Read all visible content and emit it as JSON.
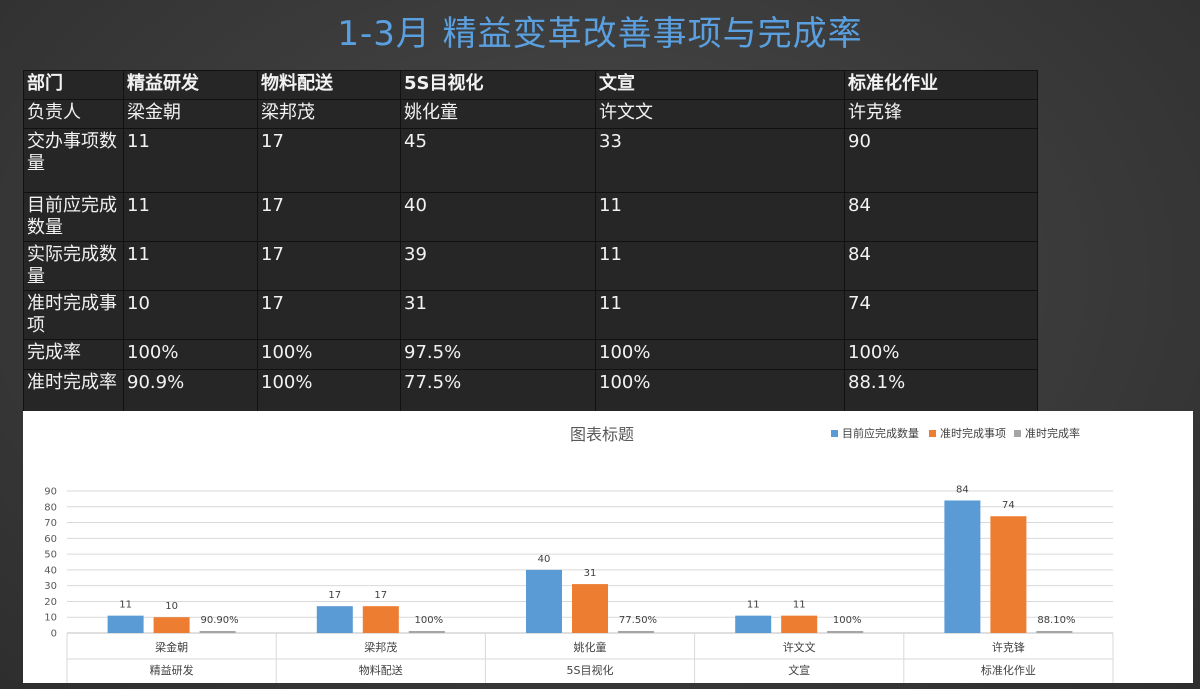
{
  "slide": {
    "title": "1-3月 精益变革改善事项与完成率"
  },
  "table": {
    "rows": [
      [
        "部门",
        "精益研发",
        "物料配送",
        "5S目视化",
        "文宣",
        "标准化作业"
      ],
      [
        "负责人",
        "梁金朝",
        "梁邦茂",
        "姚化童",
        "许文文",
        "许克锋"
      ],
      [
        "交办事项数量",
        "11",
        "17",
        "45",
        "33",
        "90"
      ],
      [
        "目前应完成数量",
        "11",
        "17",
        "40",
        "11",
        "84"
      ],
      [
        "实际完成数量",
        "11",
        "17",
        "39",
        "11",
        "84"
      ],
      [
        "准时完成事项",
        "10",
        "17",
        "31",
        "11",
        "74"
      ],
      [
        "完成率",
        "100%",
        "100%",
        "97.5%",
        "100%",
        "100%"
      ],
      [
        "准时完成率",
        "90.9%",
        "100%",
        "77.5%",
        "100%",
        "88.1%"
      ]
    ]
  },
  "chart_data": {
    "type": "bar",
    "title": "图表标题",
    "categories": [
      {
        "name": "梁金朝",
        "group": "精益研发"
      },
      {
        "name": "梁邦茂",
        "group": "物料配送"
      },
      {
        "name": "姚化童",
        "group": "5S目视化"
      },
      {
        "name": "许文文",
        "group": "文宣"
      },
      {
        "name": "许克锋",
        "group": "标准化作业"
      }
    ],
    "series": [
      {
        "name": "目前应完成数量",
        "color": "#5b9bd5",
        "values": [
          11,
          17,
          40,
          11,
          84
        ],
        "labels": [
          "11",
          "17",
          "40",
          "11",
          "84"
        ]
      },
      {
        "name": "准时完成事项",
        "color": "#ed7d31",
        "values": [
          10,
          17,
          31,
          11,
          74
        ],
        "labels": [
          "10",
          "17",
          "31",
          "11",
          "74"
        ]
      },
      {
        "name": "准时完成率",
        "color": "#a5a5a5",
        "values": [
          0.909,
          1.0,
          0.775,
          1.0,
          0.881
        ],
        "labels": [
          "90.90%",
          "100%",
          "77.50%",
          "100%",
          "88.10%"
        ]
      }
    ],
    "ylim": [
      0,
      90
    ],
    "yticks": [
      0,
      10,
      20,
      30,
      40,
      50,
      60,
      70,
      80,
      90
    ],
    "grid": true,
    "legend": "top-right",
    "xlabel": "",
    "ylabel": ""
  }
}
